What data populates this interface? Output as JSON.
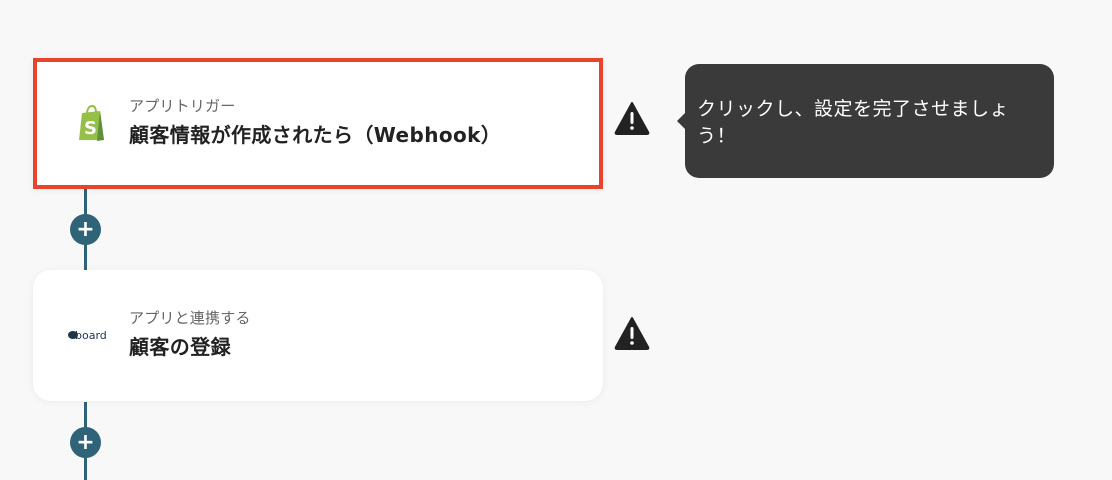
{
  "flow": {
    "steps": [
      {
        "subtitle": "アプリトリガー",
        "title": "顧客情報が作成されたら（Webhook）",
        "icon": "shopify-icon"
      },
      {
        "subtitle": "アプリと連携する",
        "title": "顧客の登録",
        "icon": "board-logo-icon",
        "logo_text": "board"
      }
    ],
    "add_label": "+",
    "tooltip": "クリックし、設定を完了させましょう！"
  },
  "colors": {
    "accent": "#2f6378",
    "highlight_border": "#e8432d",
    "shopify_green": "#95bf47",
    "tooltip_bg": "#3a3a3a",
    "warning": "#222222"
  }
}
